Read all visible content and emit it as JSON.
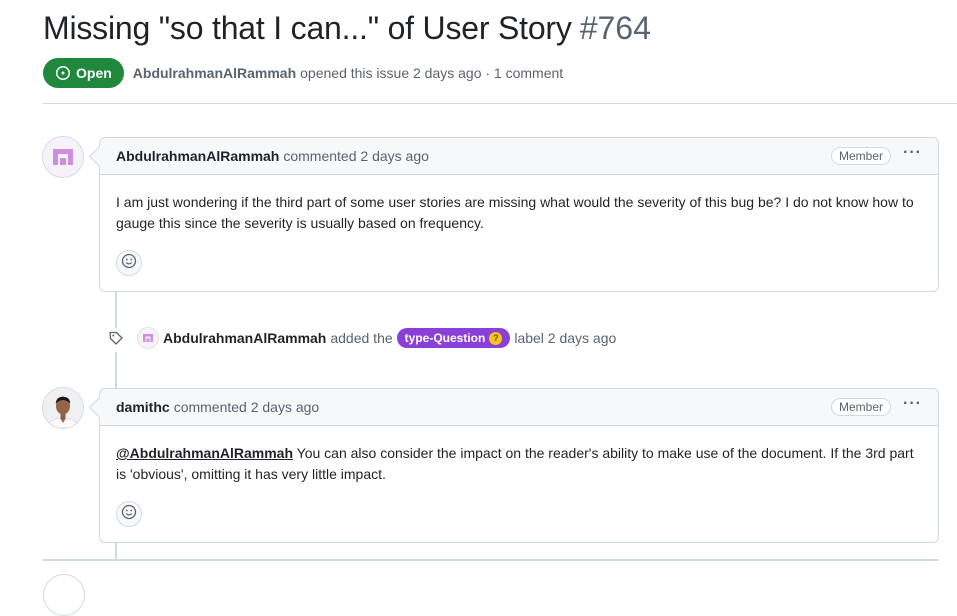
{
  "issue": {
    "title": "Missing \"so that I can...\" of User Story",
    "number": "#764",
    "state": "Open",
    "author": "AbdulrahmanAlRammah",
    "meta_text": "opened this issue 2 days ago · 1 comment"
  },
  "comments": [
    {
      "author": "AbdulrahmanAlRammah",
      "action": "commented 2 days ago",
      "role": "Member",
      "more": "···",
      "body": "I am just wondering if the third part of some user stories are missing what would the severity of this bug be? I do not know how to gauge this since the severity is usually based on frequency."
    },
    {
      "author": "damithc",
      "action": "commented 2 days ago",
      "role": "Member",
      "more": "···",
      "mention": "@AbdulrahmanAlRammah",
      "body": " You can also consider the impact on the reader's ability to make use of the document. If the 3rd part is 'obvious', omitting it has very little impact."
    }
  ],
  "event": {
    "actor": "AbdulrahmanAlRammah",
    "action_before": "added the",
    "label": "type-Question",
    "action_after": "label 2 days ago"
  },
  "colors": {
    "open_green": "#1f883d",
    "label_purple": "#8b3fd9",
    "border": "#d1d9e0"
  },
  "icons": [
    "issue-open-icon",
    "smiley-icon",
    "tag-icon",
    "kebab-horizontal-icon",
    "thinking-emoji-icon"
  ]
}
